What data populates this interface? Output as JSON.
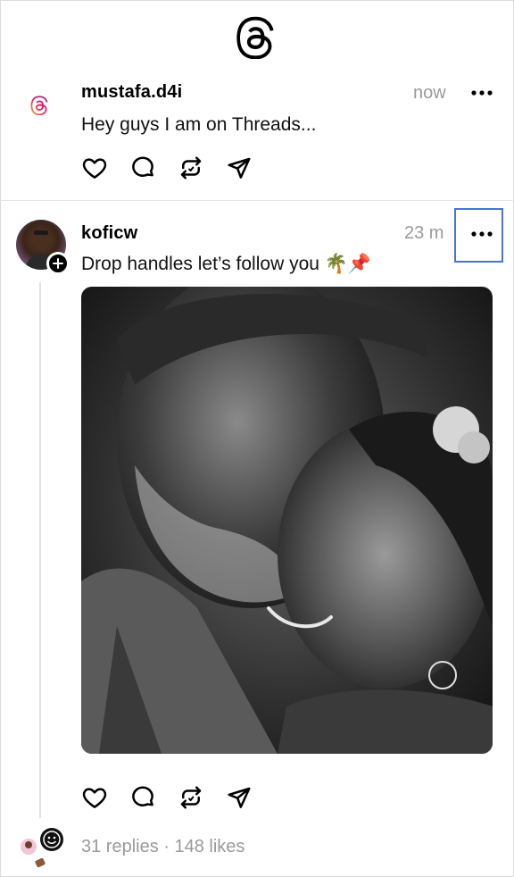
{
  "app": {
    "name": "Threads"
  },
  "posts": [
    {
      "username": "mustafa.d4i",
      "time": "now",
      "text": "Hey guys I am on Threads...",
      "avatar_icon": "threads-logo-gradient-icon"
    },
    {
      "username": "koficw",
      "time": "23 m",
      "text": "Drop handles let’s follow you 🌴📌",
      "image_alt": "Black and white photo of an elderly man embracing a smiling young girl",
      "stats": "31 replies · 148 likes"
    }
  ],
  "icons": {
    "like": "heart-icon",
    "reply": "comment-icon",
    "repost": "repost-icon",
    "share": "send-icon",
    "more": "more-horizontal-icon"
  },
  "colors": {
    "highlight": "#4a73d8",
    "muted_text": "#9a9a9a"
  }
}
